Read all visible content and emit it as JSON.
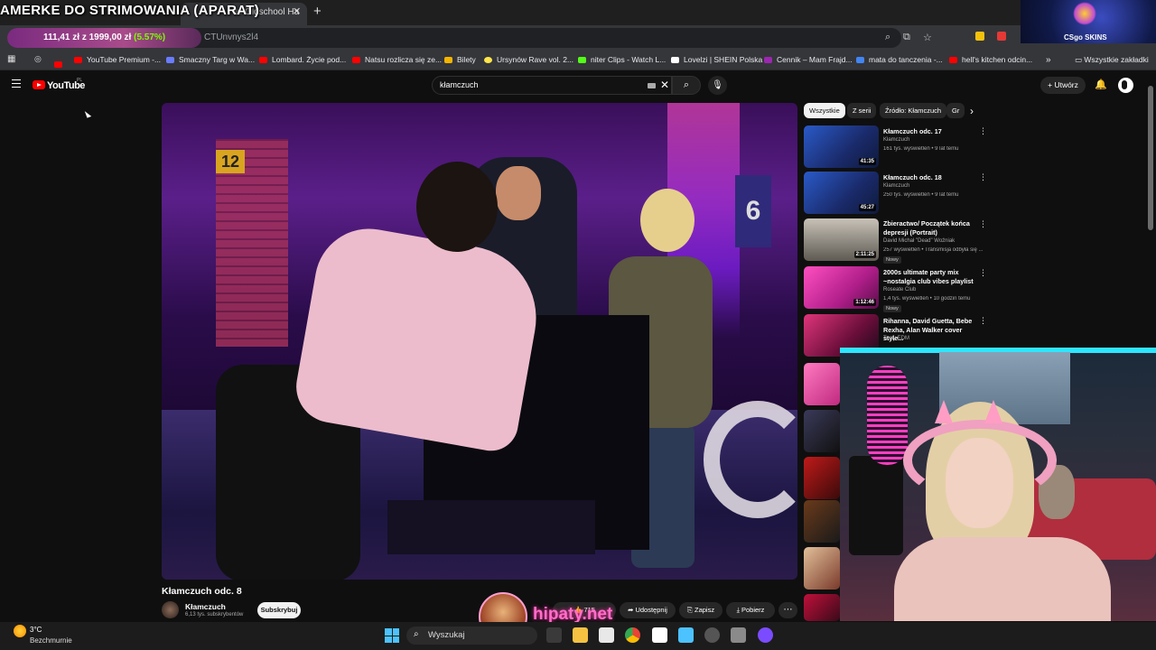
{
  "overlay": {
    "stream_title": "AMERKE DO STRIMOWANIA (APARAT)",
    "price_current": "111,41 zł",
    "price_of": "z",
    "price_goal": "1999,00 zł",
    "price_percent": "(5.57%)",
    "sponsor_label": "CSgo SKINS",
    "hipaty": "hipaty.net"
  },
  "browser": {
    "active_tab_title": "te Oldschool Ha",
    "url_fragment": "CTUnvnys2l4",
    "bookmarks": [
      "YouTube Premium -...",
      "Smaczny Targ w Wa...",
      "Lombard. Życie pod...",
      "Natsu rozlicza się ze...",
      "Bilety",
      "Ursynów Rave vol. 2...",
      "niter Clips - Watch L...",
      "Lovelzi | SHEIN Polska",
      "Cennik – Mam Frajd...",
      "mata do tanczenia -...",
      "hell's kitchen odcin..."
    ],
    "all_bookmarks": "Wszystkie zakładki"
  },
  "youtube": {
    "logo": "YouTube",
    "logo_region": "PL",
    "search_value": "kłamczuch",
    "create_label": "Utwórz",
    "video": {
      "title": "Kłamczuch odc. 8",
      "channel": "Kłamczuch",
      "subscribers": "6,13 tys. subskrybentów",
      "subscribe": "Subskrybuj",
      "likes": "715",
      "share": "Udostępnij",
      "save": "Zapisz",
      "download": "Pobierz"
    },
    "chips": [
      "Wszystkie",
      "Z serii",
      "Źródło: Kłamczuch",
      "Gr"
    ],
    "recommendations": [
      {
        "title": "Kłamczuch odc. 17",
        "channel": "Kłamczuch",
        "meta": "161 tys. wyświetleń • 9 lat temu",
        "duration": "41:35",
        "badge": ""
      },
      {
        "title": "Kłamczuch odc. 18",
        "channel": "Kłamczuch",
        "meta": "250 tys. wyświetleń • 9 lat temu",
        "duration": "45:27",
        "badge": ""
      },
      {
        "title": "Zbieractwo/ Początek końca depresji (Portrait)",
        "channel": "David Michał \"Dead\" Woźniak",
        "meta": "257 wyświetleń • Transmisja odbyła się ...",
        "duration": "2:11:25",
        "badge": "Nowy"
      },
      {
        "title": "2000s ultimate party mix ~nostalgia club vibes playlist",
        "channel": "Roseate Club",
        "meta": "1,4 tys. wyświetleń • 10 godzin temu",
        "duration": "1:12:46",
        "badge": "Nowy"
      },
      {
        "title": "Rihanna, David Guetta, Bebe Rexha, Alan Walker cover style...",
        "channel": "Tasty EDM",
        "meta": "",
        "duration": "",
        "badge": ""
      }
    ]
  },
  "taskbar": {
    "temp": "3°C",
    "condition": "Bezchmurnie",
    "search_placeholder": "Wyszukaj"
  }
}
